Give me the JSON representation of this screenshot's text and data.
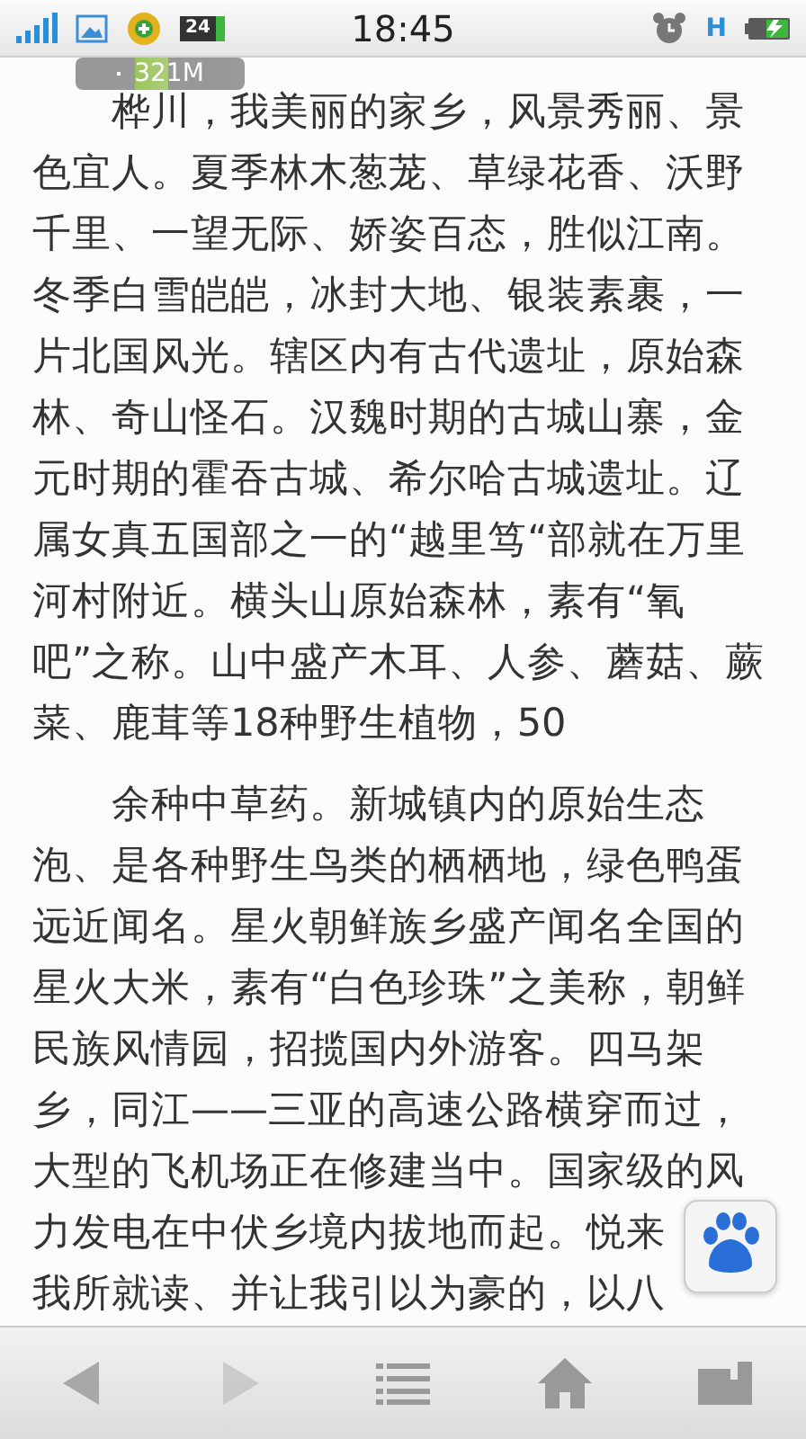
{
  "status_bar": {
    "badge": "24",
    "time": "18:45",
    "network_type": "H"
  },
  "memory_float": {
    "text": "321M"
  },
  "article": {
    "paragraphs": [
      {
        "lines": [
          "桦川，我美丽的家乡，风景秀丽、景",
          "色宜人。夏季林木葱茏、草绿花香、沃野",
          "千里、一望无际、娇姿百态，胜似江南。",
          "冬季白雪皑皑，冰封大地、银装素裹，一",
          "片北国风光。辖区内有古代遗址，原始森",
          "林、奇山怪石。汉魏时期的古城山寨，金",
          "元时期的霍吞古城、希尔哈古城遗址。辽",
          "属女真五国部之一的“越里笃“部就在万里",
          "河村附近。横头山原始森林，素有“氧",
          "吧”之称。山中盛产木耳、人参、蘑菇、蕨",
          "菜、鹿茸等18种野生植物，50"
        ]
      },
      {
        "lines": [
          "余种中草药。新城镇内的原始生态",
          "泡、是各种野生鸟类的栖栖地，绿色鸭蛋",
          "远近闻名。星火朝鲜族乡盛产闻名全国的",
          "星火大米，素有“白色珍珠”之美称，朝鲜",
          "民族风情园，招揽国内外游客。四马架",
          "乡，同江——三亚的高速公路横穿而过，",
          "大型的飞机场正在修建当中。国家级的风",
          "力发电在中伏乡境内拔地而起。悦来",
          "我所就读、并让我引以为豪的，以八"
        ]
      }
    ]
  },
  "nav_bar": [
    {
      "kind": "back",
      "disabled": false
    },
    {
      "kind": "forward",
      "disabled": true
    },
    {
      "kind": "menu",
      "disabled": false
    },
    {
      "kind": "home",
      "disabled": false
    },
    {
      "kind": "windows",
      "disabled": false
    }
  ]
}
